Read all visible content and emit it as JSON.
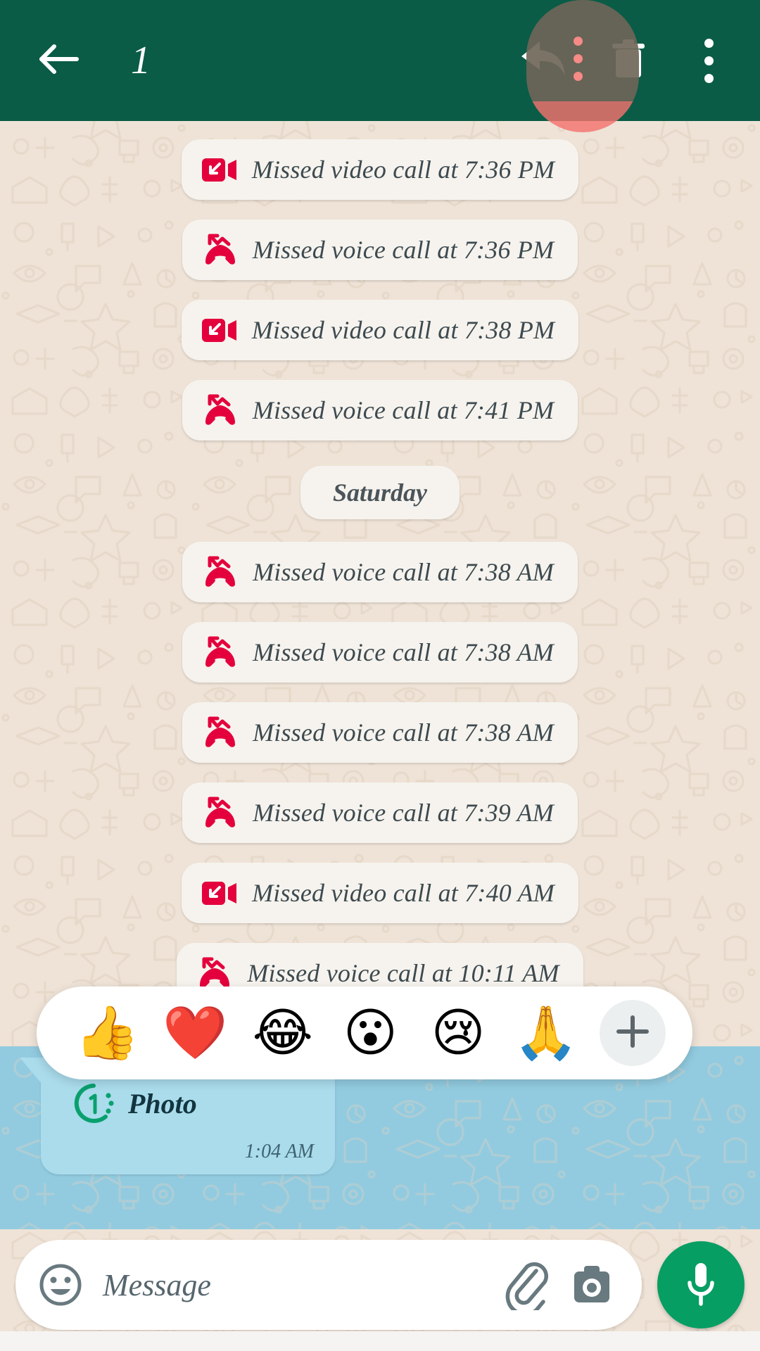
{
  "toolbar": {
    "back_icon": "arrow-left-icon",
    "selected_count": "1",
    "reply_icon": "reply-arrow-icon",
    "delete_icon": "trash-icon",
    "overflow_icon": "three-dot-menu-icon",
    "background_color": "#0a5c47",
    "ripple_color": "#f4736e"
  },
  "chat": {
    "wallpaper_color": "#efe3d7",
    "messages": [
      {
        "type": "call",
        "kind": "video",
        "icon": "missed-video-call-icon",
        "text": "Missed video call at 7:36 PM"
      },
      {
        "type": "call",
        "kind": "voice",
        "icon": "missed-voice-call-icon",
        "text": "Missed voice call at 7:36 PM"
      },
      {
        "type": "call",
        "kind": "video",
        "icon": "missed-video-call-icon",
        "text": "Missed video call at 7:38 PM"
      },
      {
        "type": "call",
        "kind": "voice",
        "icon": "missed-voice-call-icon",
        "text": "Missed voice call at 7:41 PM"
      },
      {
        "type": "date",
        "text": "Saturday"
      },
      {
        "type": "call",
        "kind": "voice",
        "icon": "missed-voice-call-icon",
        "text": "Missed voice call at 7:38 AM"
      },
      {
        "type": "call",
        "kind": "voice",
        "icon": "missed-voice-call-icon",
        "text": "Missed voice call at 7:38 AM"
      },
      {
        "type": "call",
        "kind": "voice",
        "icon": "missed-voice-call-icon",
        "text": "Missed voice call at 7:38 AM"
      },
      {
        "type": "call",
        "kind": "voice",
        "icon": "missed-voice-call-icon",
        "text": "Missed voice call at 7:39 AM"
      },
      {
        "type": "call",
        "kind": "video",
        "icon": "missed-video-call-icon",
        "text": "Missed video call at 7:40 AM"
      },
      {
        "type": "call",
        "kind": "voice",
        "icon": "missed-voice-call-icon",
        "text": "Missed voice call at 10:11 AM"
      }
    ],
    "call_icon_color": "#e4003c",
    "call_text_color": "#3d4a4f"
  },
  "selected_message": {
    "icon": "view-once-photo-icon",
    "label": "Photo",
    "timestamp": "1:04 AM",
    "selection_color": "#92cbe0",
    "bubble_color": "#aadcec"
  },
  "reaction_bar": {
    "emojis": [
      {
        "name": "thumbs-up-emoji",
        "glyph": "👍"
      },
      {
        "name": "red-heart-emoji",
        "glyph": "❤️"
      },
      {
        "name": "face-with-tears-of-joy-emoji",
        "glyph": "😂"
      },
      {
        "name": "face-with-open-mouth-emoji",
        "glyph": "😮"
      },
      {
        "name": "crying-face-emoji",
        "glyph": "😢"
      },
      {
        "name": "folded-hands-emoji",
        "glyph": "🙏"
      }
    ],
    "more_icon": "plus-icon"
  },
  "composer": {
    "emoji_icon": "smiley-face-icon",
    "placeholder": "Message",
    "attach_icon": "paperclip-icon",
    "camera_icon": "camera-icon",
    "mic_icon": "microphone-icon",
    "mic_button_color": "#069e63"
  }
}
